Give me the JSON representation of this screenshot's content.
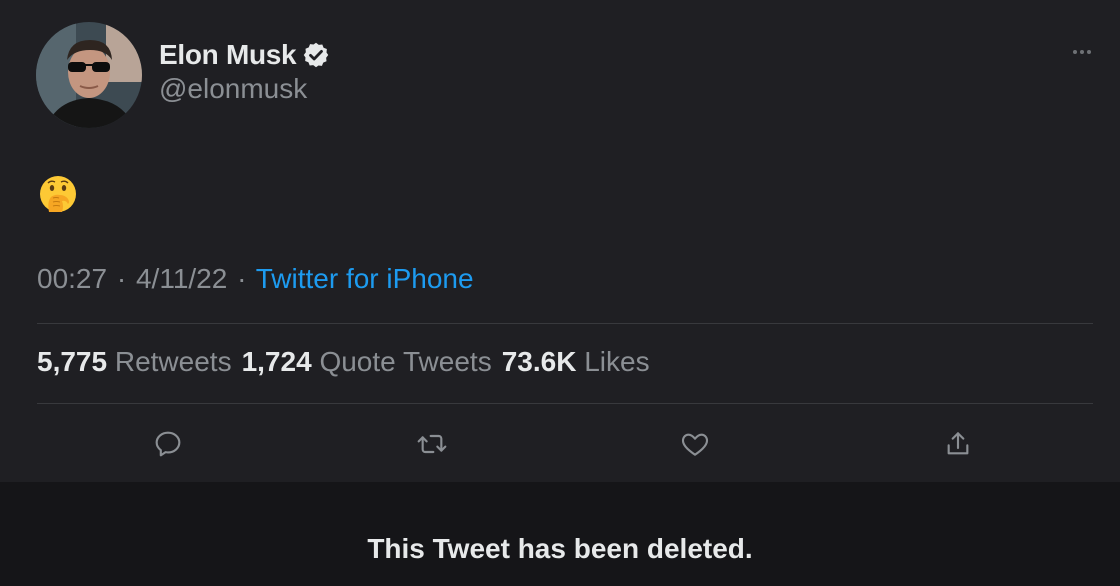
{
  "tweet": {
    "author": {
      "name": "Elon Musk",
      "handle": "@elonmusk",
      "verified": true,
      "avatar_icon": "profile-photo"
    },
    "body": {
      "emoji": "🤭",
      "emoji_icon": "face-with-hand-over-mouth-emoji"
    },
    "meta": {
      "time": "00:27",
      "date": "4/11/22",
      "separator": "·",
      "source": "Twitter for iPhone"
    },
    "stats": {
      "retweets_count": "5,775",
      "retweets_label": "Retweets",
      "quotes_count": "1,724",
      "quotes_label": "Quote Tweets",
      "likes_count": "73.6K",
      "likes_label": "Likes"
    },
    "actions": [
      {
        "icon": "reply-icon"
      },
      {
        "icon": "retweet-icon"
      },
      {
        "icon": "like-icon"
      },
      {
        "icon": "share-icon"
      }
    ],
    "more_icon": "more-options-icon"
  },
  "banner": {
    "text": "This Tweet has been deleted."
  },
  "colors": {
    "background": "#1f1f23",
    "banner_background": "#151518",
    "primary_text": "#e7e9ea",
    "secondary_text": "#8b8f94",
    "link": "#1d9bf0",
    "divider": "#38393d"
  }
}
